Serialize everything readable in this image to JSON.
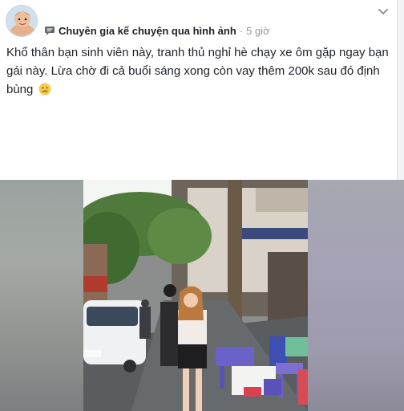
{
  "post": {
    "author": "Chuyên gia kể chuyện qua hình ảnh",
    "separator": "·",
    "time": "5 giờ",
    "text": "Khổ thân bạn sinh viên này, tranh thủ nghỉ hè chạy xe ôm gặp ngay bạn gái này. Lừa chờ đi cả buổi sáng xong còn vay thêm 200k sau đó định bùng"
  },
  "icons": {
    "author_badge": "chat-bubble-icon",
    "menu": "chevron-down-icon",
    "emoji": "sad-face-emoji"
  }
}
